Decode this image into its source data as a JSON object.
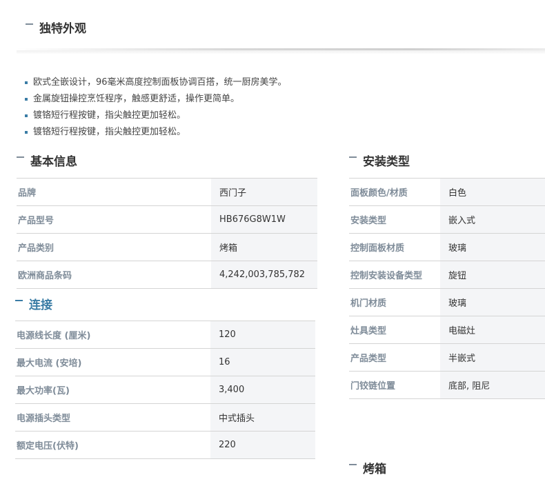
{
  "sections": {
    "unique_look": "独特外观",
    "basic_info": "基本信息",
    "installation_type": "安装类型",
    "connection": "连接",
    "oven": "烤箱"
  },
  "features": [
    "欧式全嵌设计，96毫米高度控制面板协调百搭，统一厨房美学。",
    "金属旋钮操控烹饪程序，触感更舒适，操作更简单。",
    "镀铬短行程按键，指尖触控更加轻松。",
    "镀铬短行程按键，指尖触控更加轻松。"
  ],
  "basic_info_rows": [
    {
      "label": "品牌",
      "value": "西门子"
    },
    {
      "label": "产品型号",
      "value": "HB676G8W1W"
    },
    {
      "label": "产品类别",
      "value": "烤箱"
    },
    {
      "label": "欧洲商品条码",
      "value": "4,242,003,785,782"
    }
  ],
  "connection_rows": [
    {
      "label": "电源线长度 (厘米)",
      "value": "120"
    },
    {
      "label": "最大电流 (安培)",
      "value": "16"
    },
    {
      "label": "最大功率(瓦)",
      "value": "3,400"
    },
    {
      "label": "电源插头类型",
      "value": "中式插头"
    },
    {
      "label": "额定电压(伏特)",
      "value": "220"
    }
  ],
  "installation_rows": [
    {
      "label": "面板颜色/材质",
      "value": "白色"
    },
    {
      "label": "安装类型",
      "value": "嵌入式"
    },
    {
      "label": "控制面板材质",
      "value": "玻璃"
    },
    {
      "label": "控制安装设备类型",
      "value": "旋钮"
    },
    {
      "label": "机门材质",
      "value": "玻璃"
    },
    {
      "label": "灶具类型",
      "value": "电磁灶"
    },
    {
      "label": "产品类型",
      "value": "半嵌式"
    },
    {
      "label": "门铰链位置",
      "value": "底部, 阻尼"
    }
  ]
}
